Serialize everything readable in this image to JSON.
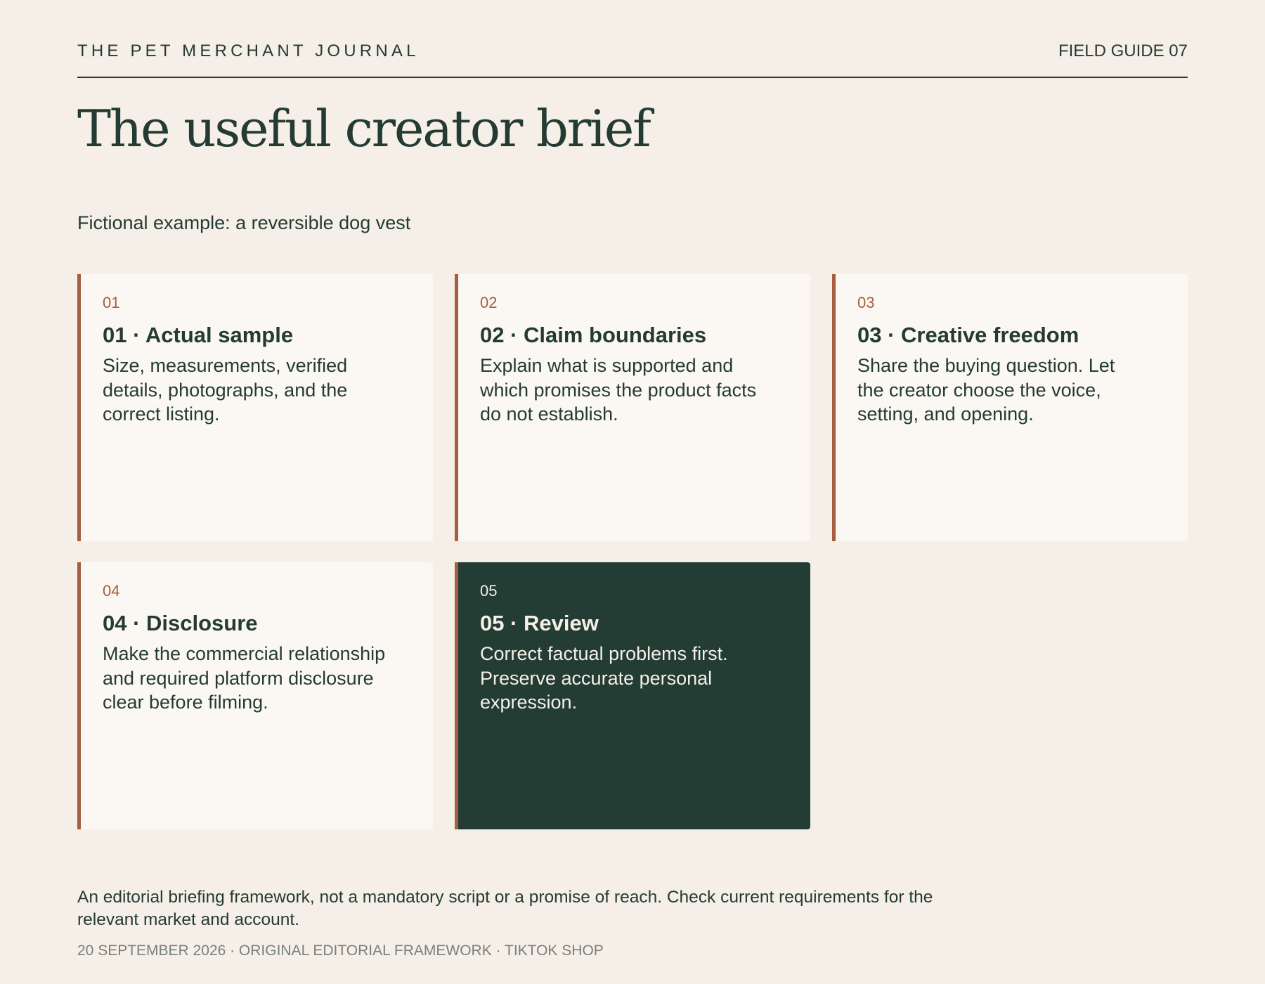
{
  "header": {
    "brand": "THE PET MERCHANT JOURNAL",
    "guide": "FIELD GUIDE 07"
  },
  "title": "The useful creator brief",
  "subtitle": "Fictional example: a reversible dog vest",
  "cards": [
    {
      "number": "01",
      "title": "01 · Actual sample",
      "body": "Size, measurements, verified details, photographs, and the correct listing."
    },
    {
      "number": "02",
      "title": "02 · Claim boundaries",
      "body": "Explain what is supported and which promises the product facts do not establish."
    },
    {
      "number": "03",
      "title": "03 · Creative freedom",
      "body": "Share the buying question. Let the creator choose the voice, setting, and opening."
    },
    {
      "number": "04",
      "title": "04 · Disclosure",
      "body": "Make the commercial relationship and required platform disclosure clear before filming."
    },
    {
      "number": "05",
      "title": "05 · Review",
      "body": "Correct factual problems first. Preserve accurate personal expression."
    }
  ],
  "note": "An editorial briefing framework, not a mandatory script or a promise of reach. Check current requirements for the relevant market and account.",
  "footer": "20 SEPTEMBER 2026 · ORIGINAL EDITORIAL FRAMEWORK · TIKTOK SHOP",
  "colors": {
    "background": "#f5efe8",
    "ink": "#243b33",
    "accent": "#a75d40",
    "card": "#fbf8f3",
    "highlight_card": "#233d34"
  }
}
